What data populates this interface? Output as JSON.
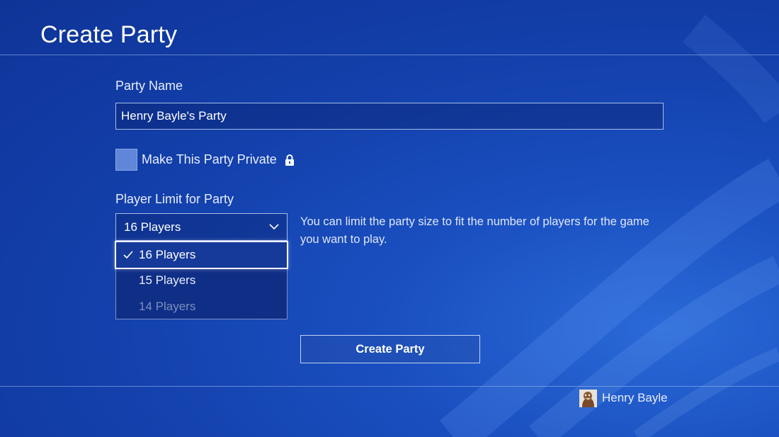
{
  "page": {
    "title": "Create Party"
  },
  "form": {
    "party_name_label": "Party Name",
    "party_name_value": "Henry Bayle's Party",
    "private_checkbox_label": "Make This Party Private",
    "private_checked": false,
    "player_limit_label": "Player Limit for Party",
    "player_limit_selected": "16 Players",
    "player_limit_options": [
      {
        "label": "16 Players",
        "state": "selected"
      },
      {
        "label": "15 Players",
        "state": "normal"
      },
      {
        "label": "14 Players",
        "state": "faded"
      }
    ],
    "player_limit_hint": "You can limit the party size to fit the number of players for the game you want to play.",
    "submit_label": "Create Party"
  },
  "footer": {
    "user_name": "Henry Bayle"
  },
  "icons": {
    "lock": "lock-icon",
    "dropdown": "chevron-down-icon",
    "selected_option": "checkmark-icon",
    "avatar": "user-avatar"
  },
  "colors": {
    "background": "#1340ab",
    "accent_border": "#ffffff",
    "checkbox_fill": "#5f86d8"
  }
}
